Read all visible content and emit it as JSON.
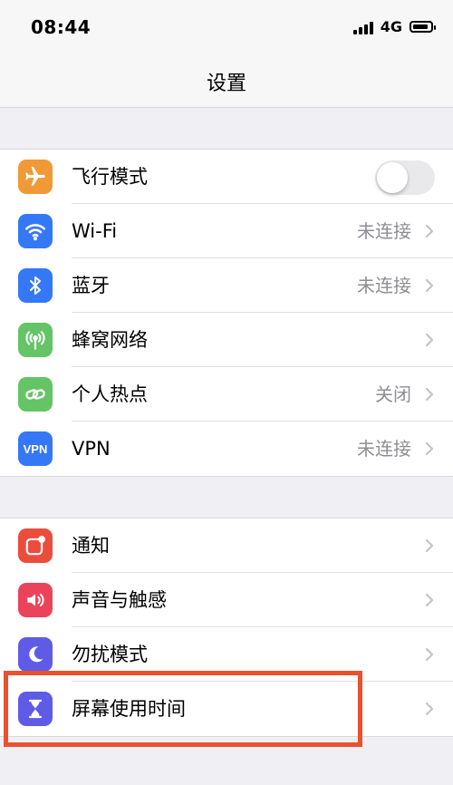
{
  "status": {
    "time": "08:44",
    "network": "4G"
  },
  "nav": {
    "title": "设置"
  },
  "group1": [
    {
      "label": "飞行模式",
      "value": "",
      "icon": "airplane-icon",
      "color": "#f09a37"
    },
    {
      "label": "Wi-Fi",
      "value": "未连接",
      "icon": "wifi-icon",
      "color": "#3478f6"
    },
    {
      "label": "蓝牙",
      "value": "未连接",
      "icon": "bluetooth-icon",
      "color": "#3478f6"
    },
    {
      "label": "蜂窝网络",
      "value": "",
      "icon": "cellular-antenna-icon",
      "color": "#65c466"
    },
    {
      "label": "个人热点",
      "value": "关闭",
      "icon": "hotspot-link-icon",
      "color": "#65c466"
    },
    {
      "label": "VPN",
      "value": "未连接",
      "icon": "vpn-icon",
      "icon_text": "VPN",
      "color": "#3478f6"
    }
  ],
  "group2": [
    {
      "label": "通知",
      "icon": "notifications-icon",
      "color": "#eb4d3d"
    },
    {
      "label": "声音与触感",
      "icon": "speaker-icon",
      "color": "#eb445a"
    },
    {
      "label": "勿扰模式",
      "icon": "moon-icon",
      "color": "#5e5ce6"
    },
    {
      "label": "屏幕使用时间",
      "icon": "hourglass-icon",
      "color": "#5e5ce6"
    }
  ],
  "airplane_mode_on": false,
  "highlight_color": "#e8522e"
}
